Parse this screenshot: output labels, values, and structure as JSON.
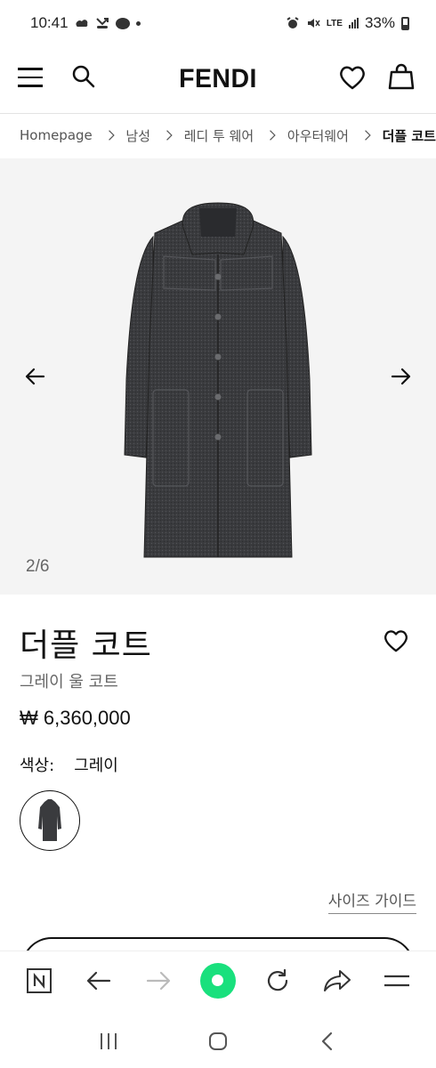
{
  "status_bar": {
    "time": "10:41",
    "network": "LTE",
    "battery": "33%"
  },
  "header": {
    "brand": "FENDI",
    "icons": [
      "menu-icon",
      "search-icon",
      "heart-icon",
      "bag-icon"
    ]
  },
  "breadcrumb": {
    "items": [
      {
        "label": "Homepage"
      },
      {
        "label": "남성"
      },
      {
        "label": "레디 투 웨어"
      },
      {
        "label": "아우터웨어"
      },
      {
        "label": "더플 코트"
      }
    ]
  },
  "gallery": {
    "counter": "2/6"
  },
  "product": {
    "title": "더플 코트",
    "subtitle": "그레이 울 코트",
    "price": "₩ 6,360,000",
    "color_label": "색상:",
    "color_value": "그레이",
    "size_guide": "사이즈 가이드"
  },
  "colors": {
    "coat": "#3a3b3e",
    "accent_green": "#19e07d"
  }
}
